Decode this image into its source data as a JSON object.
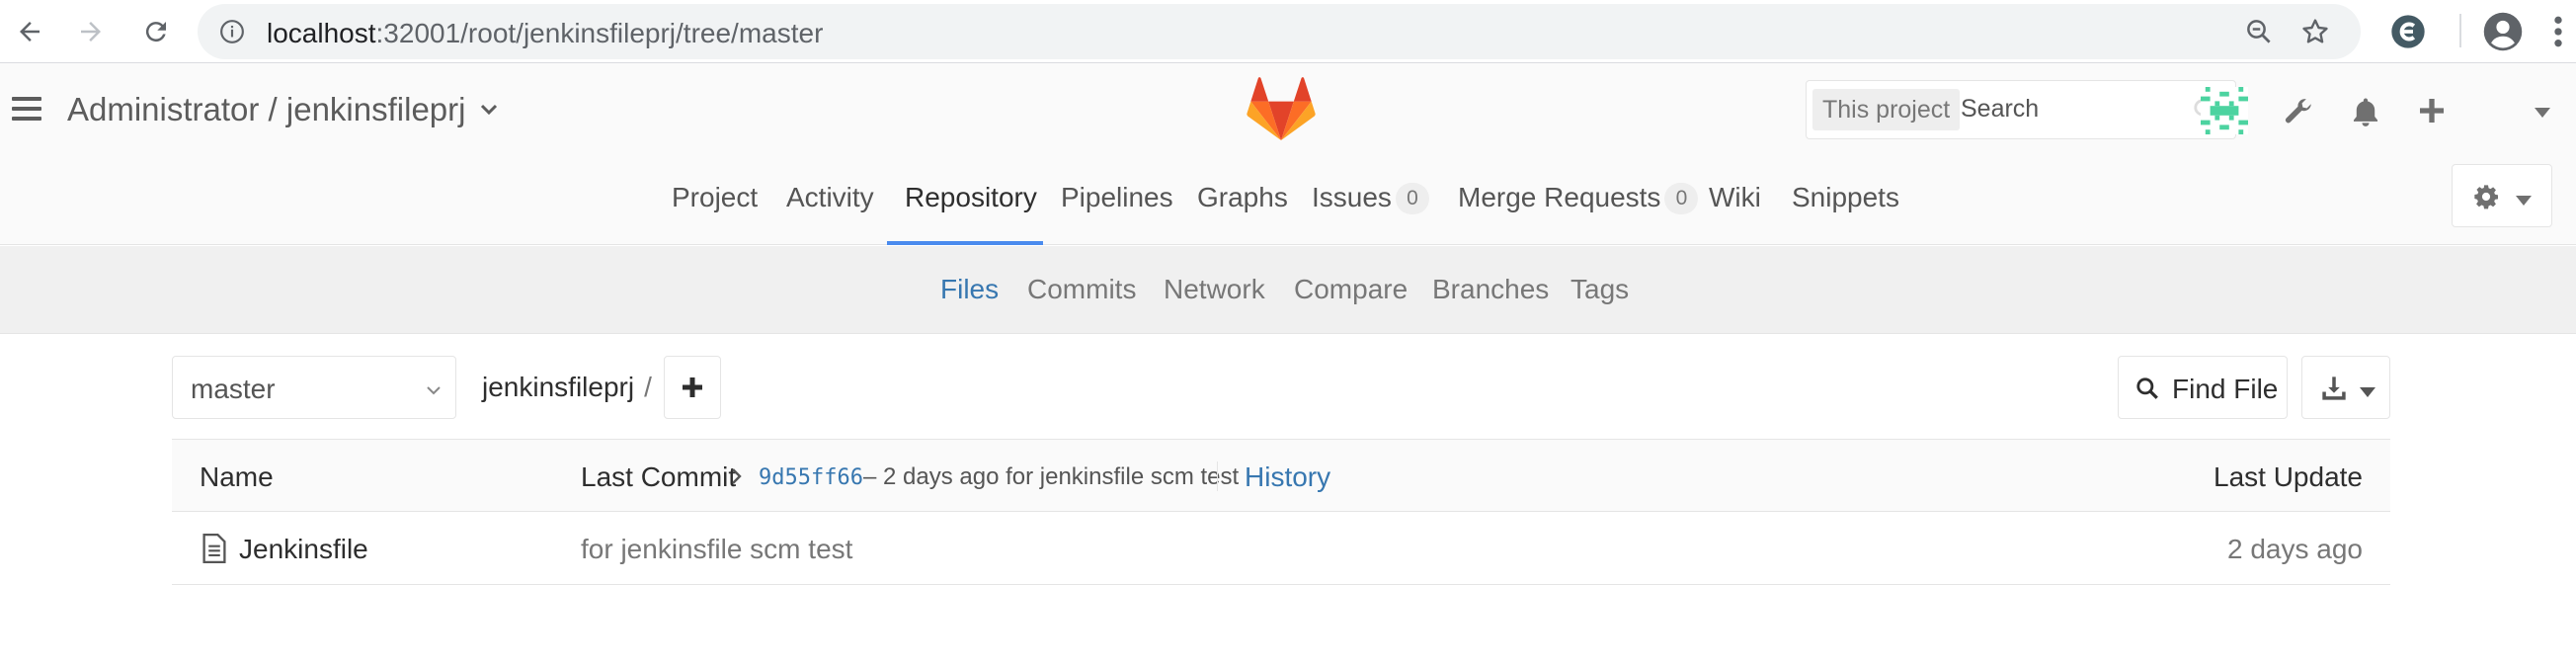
{
  "browser": {
    "url_host": "localhost",
    "url_rest": ":32001/root/jenkinsfileprj/tree/master"
  },
  "header": {
    "project_title": "Administrator / jenkinsfileprj",
    "search_scope": "This project",
    "search_placeholder": "Search",
    "brand_color": "#e24329"
  },
  "project_nav": [
    {
      "label": "Project"
    },
    {
      "label": "Activity"
    },
    {
      "label": "Repository",
      "active": true
    },
    {
      "label": "Pipelines"
    },
    {
      "label": "Graphs"
    },
    {
      "label": "Issues",
      "count": "0"
    },
    {
      "label": "Merge Requests",
      "count": "0"
    },
    {
      "label": "Wiki"
    },
    {
      "label": "Snippets"
    }
  ],
  "sub_nav": [
    {
      "label": "Files",
      "active": true
    },
    {
      "label": "Commits"
    },
    {
      "label": "Network"
    },
    {
      "label": "Compare"
    },
    {
      "label": "Branches"
    },
    {
      "label": "Tags"
    }
  ],
  "toolbar": {
    "branch": "master",
    "breadcrumb_project": "jenkinsfileprj",
    "breadcrumb_sep": "/",
    "find_file": "Find File"
  },
  "table": {
    "col_name": "Name",
    "col_last_commit": "Last Commit",
    "commit_sha": "9d55ff66",
    "commit_meta": "– 2 days ago for jenkinsfile scm test",
    "history": "History",
    "col_last_update": "Last Update",
    "rows": [
      {
        "name": "Jenkinsfile",
        "message": "for jenkinsfile scm test",
        "updated": "2 days ago"
      }
    ]
  },
  "icons": {
    "back": "back-arrow-icon",
    "forward": "forward-arrow-icon",
    "reload": "reload-icon",
    "info": "info-icon",
    "zoom": "zoom-icon",
    "star": "star-icon",
    "extension": "extension-icon",
    "profile": "profile-icon",
    "menu": "kebab-menu-icon",
    "hamburger": "hamburger-icon",
    "logo": "gitlab-logo",
    "search": "search-icon",
    "wrench": "wrench-icon",
    "bell": "bell-icon",
    "plus": "plus-icon",
    "avatar": "user-avatar",
    "gear": "gear-icon",
    "file": "file-icon",
    "download": "download-icon"
  }
}
